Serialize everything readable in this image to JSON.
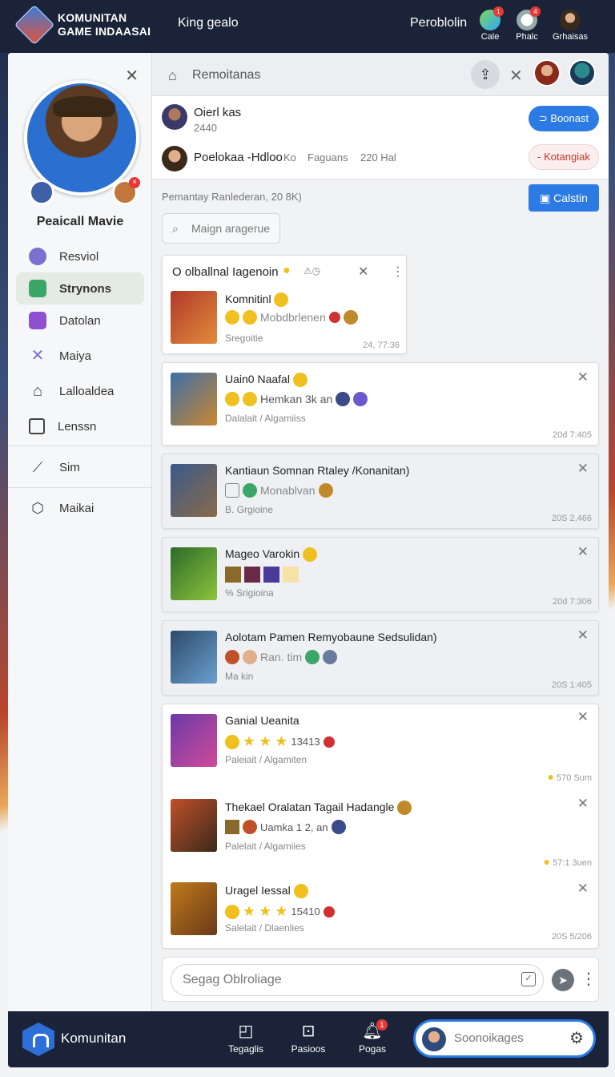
{
  "header": {
    "brand_line1": "KOMUNITAN",
    "brand_line2": "GAME INDAASAI",
    "title": "King gealo",
    "profile_link": "Peroblolin",
    "icons": [
      {
        "name": "cale-icon",
        "label": "Cale",
        "badge": "1",
        "color": "#4caf50"
      },
      {
        "name": "phalc-icon",
        "label": "Phalc",
        "badge": "4",
        "color": "#e0e0e0"
      },
      {
        "name": "grhaisas-icon",
        "label": "Grhaisas",
        "badge": "",
        "color": "#c07a4a"
      }
    ]
  },
  "sidebar": {
    "profile_name": "Peaicall Mavie",
    "items": [
      {
        "label": "Resviol",
        "icon": "circle-icon",
        "color": "#7b6fd0"
      },
      {
        "label": "Strynons",
        "icon": "chat-icon",
        "color": "#3aa768",
        "active": true
      },
      {
        "label": "Datolan",
        "icon": "square-icon",
        "color": "#8e4fd1"
      },
      {
        "label": "Maiya",
        "icon": "cross-icon",
        "color": "#7b6fd0"
      },
      {
        "label": "Lalloaldea",
        "icon": "house-icon",
        "color": "#555"
      },
      {
        "label": "Lenssn",
        "icon": "minus-box-icon",
        "color": "#555"
      },
      {
        "label": "Sim",
        "icon": "chart-icon",
        "color": "#555"
      },
      {
        "label": "Maikai",
        "icon": "cube-icon",
        "color": "#555"
      }
    ]
  },
  "breadcrumb": {
    "text": "Remoitanas"
  },
  "user_card": {
    "row1_name": "Oierl kas",
    "row1_sub": "2440",
    "row1_button": "Boonast",
    "row2_name": "Poelokaa -Hdloo",
    "row2_extra1": "Ko",
    "row2_extra2": "Faguans",
    "row2_extra3": "220 Hal",
    "row2_button": "Kotangiak"
  },
  "meta_line": "Pemantay Ranlederan, 20 8K)",
  "calstin_button": "Calstin",
  "search_pill": "Maign aragerue",
  "feed": [
    {
      "title": "O olballnal Iagenoin",
      "line": "Komnitinl",
      "line2": "Mobdbrlenen",
      "sub": "Sregoitie",
      "time": "24, 77:36",
      "colors": [
        "#b23a2a",
        "#e28b3c"
      ]
    },
    {
      "title": "Uain0 Naafal",
      "line": "Hemkan 3k an",
      "sub": "Dalalait / Algamiiss",
      "time": "20d 7:405",
      "colors": [
        "#3b6fa8",
        "#c9872f"
      ]
    },
    {
      "title": "Kantiaun Somnan Rtaley /Konanitan)",
      "line": "Monablvan",
      "sub": "B. Grgioine",
      "time": "20S 2,466",
      "colors": [
        "#3a5a8a",
        "#8a6a4a"
      ]
    },
    {
      "title": "Mageo Varokin",
      "line": "",
      "sub": "% Srigioina",
      "time": "20d 7:306",
      "colors": [
        "#2d6a2a",
        "#8cc43c"
      ]
    },
    {
      "title": "Aolotam Pamen Remyobaune Sedsulidan)",
      "line": "Ran. tim",
      "line2": "Ma kin",
      "sub": "",
      "time": "20S 1:405",
      "colors": [
        "#2d4a6a",
        "#6aa0d0"
      ]
    },
    {
      "title": "Ganial Ueanita",
      "line": "13413",
      "sub": "Paleiait / Algamiten",
      "time": "570 Sum",
      "colors": [
        "#6a3aa8",
        "#d04a9a"
      ]
    },
    {
      "title": "Thekael Oralatan Tagail Hadangle",
      "line": "Uamka 1 2, an",
      "sub": "Palelait / Algamiies",
      "time": "57:1 3uen",
      "colors": [
        "#c0502a",
        "#3a2a1a"
      ]
    },
    {
      "title": "Uragel Iessal",
      "line": "15410",
      "sub": "Salelait / Dlaenlies",
      "time": "20S 5/206",
      "colors": [
        "#c07a1a",
        "#6a3a1a"
      ]
    }
  ],
  "composer": {
    "placeholder": "Segag Oblroliage"
  },
  "bottom_nav": {
    "label": "Komunitan",
    "items": [
      {
        "label": "Tegaglis",
        "icon": "square-icon"
      },
      {
        "label": "Pasioos",
        "icon": "chat-icon"
      },
      {
        "label": "Pogas",
        "icon": "bell-icon",
        "badge": "1"
      }
    ],
    "search_placeholder": "Soonoikages"
  }
}
